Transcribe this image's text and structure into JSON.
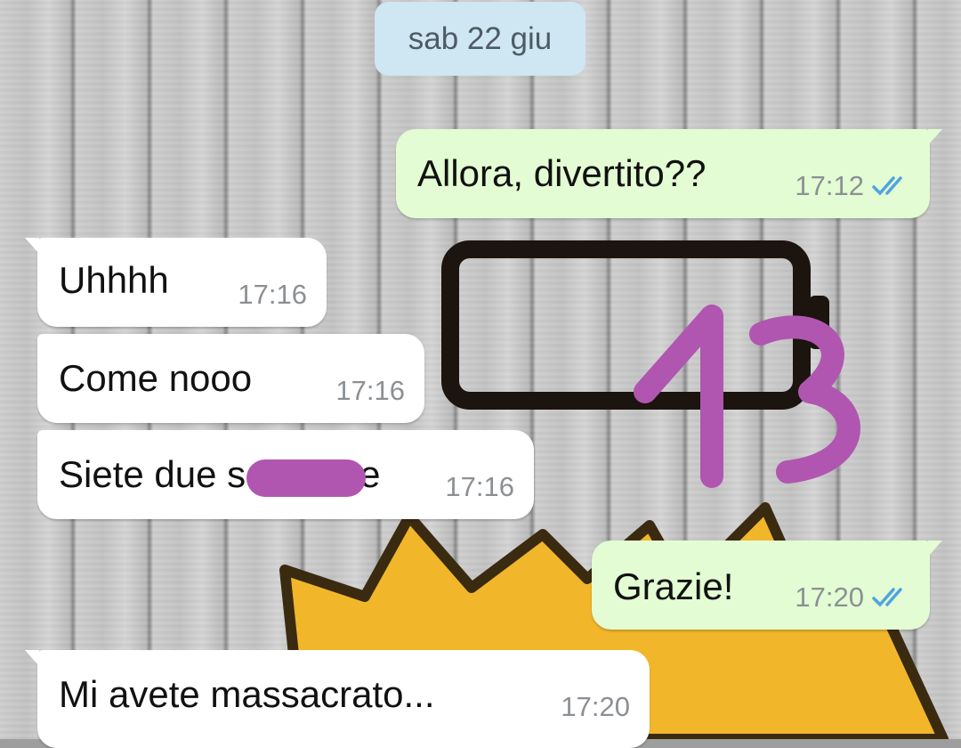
{
  "date_chip": "sab 22 giu",
  "messages": [
    {
      "direction": "out",
      "text": "Allora, divertito??",
      "time": "17:12",
      "status": "read"
    },
    {
      "direction": "in",
      "text": "Uhhhh",
      "time": "17:16"
    },
    {
      "direction": "in",
      "text": "Come nooo",
      "time": "17:16"
    },
    {
      "direction": "in",
      "text_start": "Siete due s",
      "text_end": "e",
      "redacted": true,
      "time": "17:16"
    },
    {
      "direction": "out",
      "text": "Grazie!",
      "time": "17:20",
      "status": "read"
    },
    {
      "direction": "in",
      "text": "Mi avete massacrato...",
      "time": "17:20"
    }
  ],
  "overlay_annotation": "13",
  "colors": {
    "outgoing_bubble": "#e3fcd3",
    "incoming_bubble": "#ffffff",
    "read_ticks": "#4fa3e0",
    "annotation": "#b056b0",
    "date_chip": "#cfe6f3"
  },
  "icons": {
    "read_receipt": "double-check-icon"
  }
}
